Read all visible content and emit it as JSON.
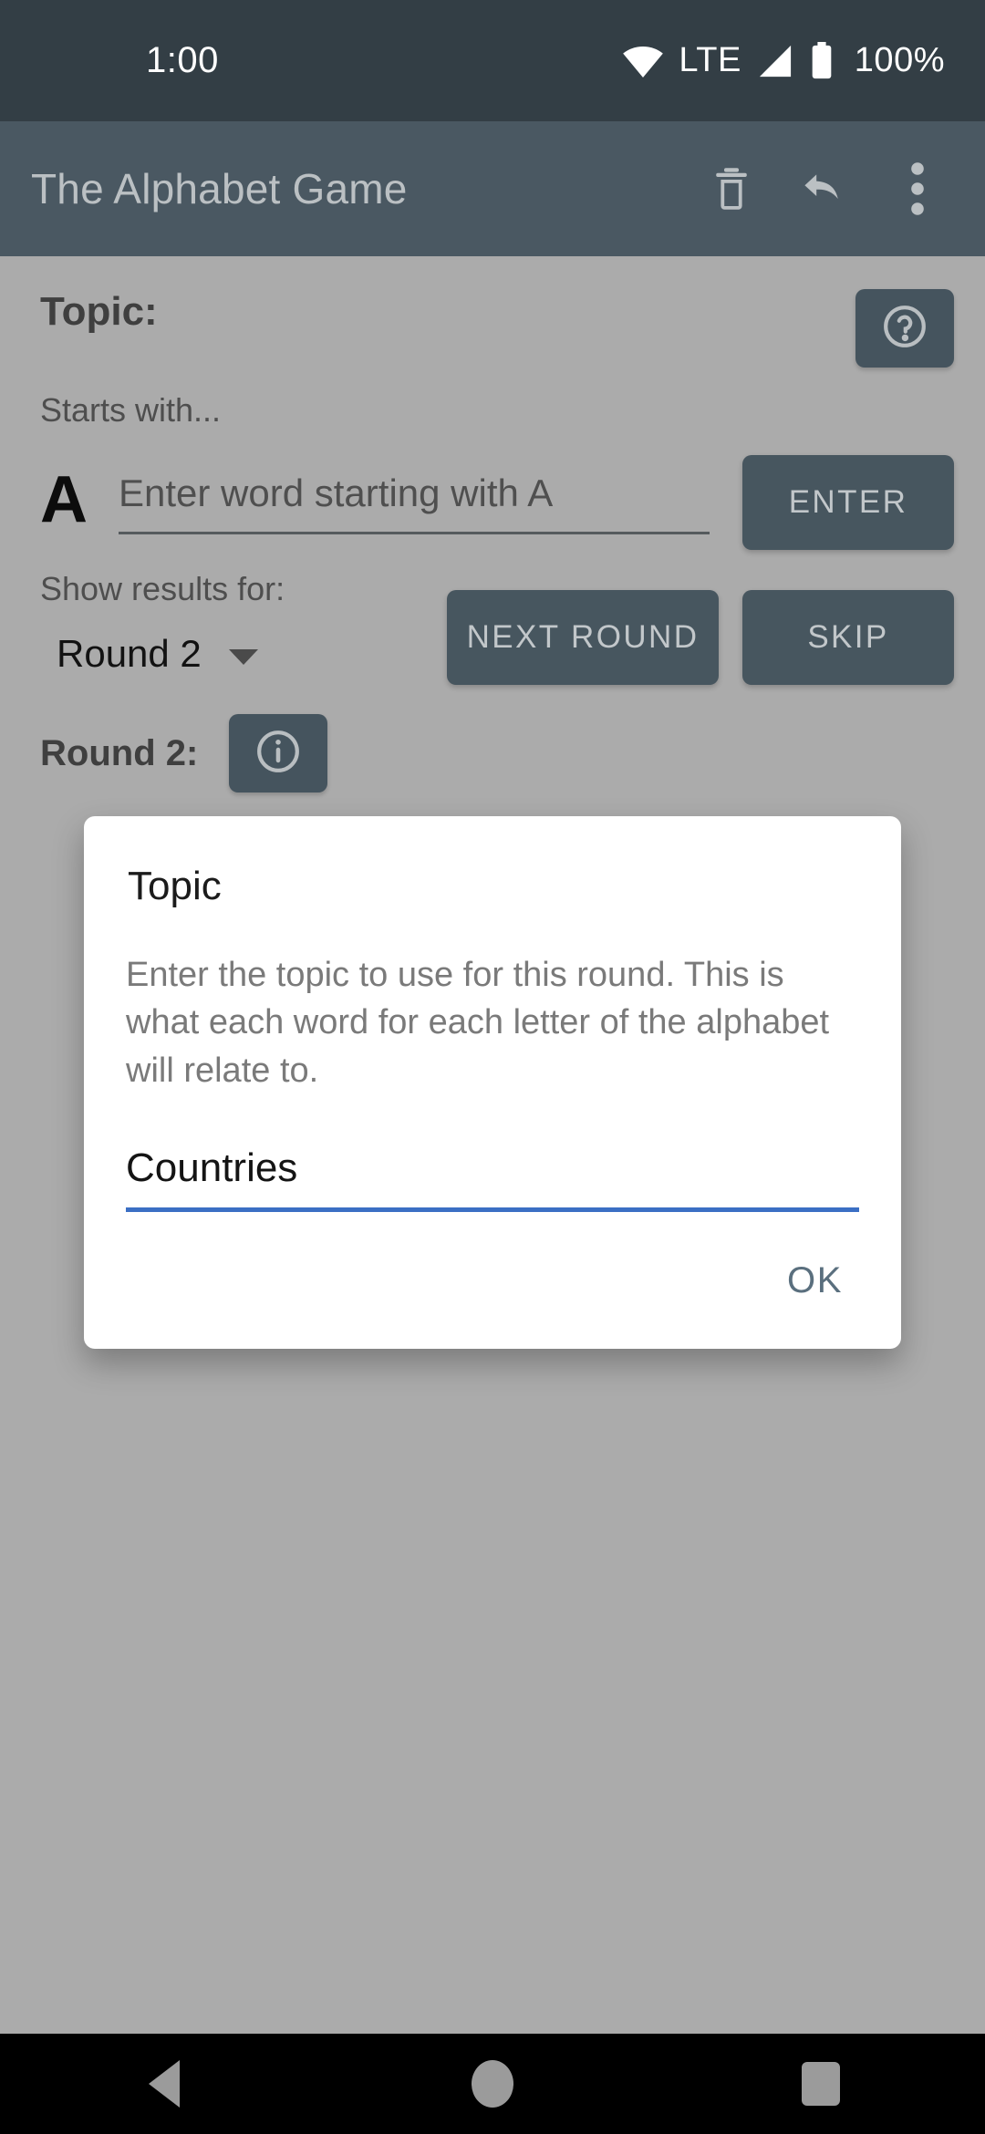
{
  "status_bar": {
    "clock": "1:00",
    "wifi_icon": "wifi-icon",
    "network_label": "LTE",
    "signal_icon": "signal-bars-icon",
    "battery_icon": "battery-full-icon",
    "battery_label": "100%",
    "background": "#333E45"
  },
  "app_bar": {
    "title": "The Alphabet Game",
    "background": "#4A5862",
    "actions": [
      {
        "name": "delete-icon",
        "label": "Delete"
      },
      {
        "name": "undo-icon",
        "label": "Undo"
      },
      {
        "name": "overflow-menu-icon",
        "label": "More options"
      }
    ]
  },
  "main": {
    "topic_label": "Topic:",
    "help_button_icon": "help-circle-icon",
    "starts_with_label": "Starts with...",
    "current_letter": "A",
    "word_input_placeholder": "Enter word starting with A",
    "word_input_value": "",
    "enter_button": "ENTER",
    "show_results_label": "Show results for:",
    "round_spinner_value": "Round 2",
    "next_round_button": "NEXT ROUND",
    "skip_button": "SKIP",
    "round_heading": "Round 2:",
    "round_info_icon": "info-circle-icon",
    "scrim_color": "#ABABAB",
    "button_color": "#47565F"
  },
  "dialog": {
    "title": "Topic",
    "message": "Enter the topic to use for this round. This is what each word for each letter of the alphabet will relate to.",
    "input_value": "Countries",
    "input_underline_color": "#3B6FC4",
    "ok_button": "OK",
    "ok_button_color": "#5A6F7E"
  },
  "nav_bar": {
    "back_icon": "back-triangle-icon",
    "home_icon": "home-circle-icon",
    "recents_icon": "recents-square-icon"
  }
}
